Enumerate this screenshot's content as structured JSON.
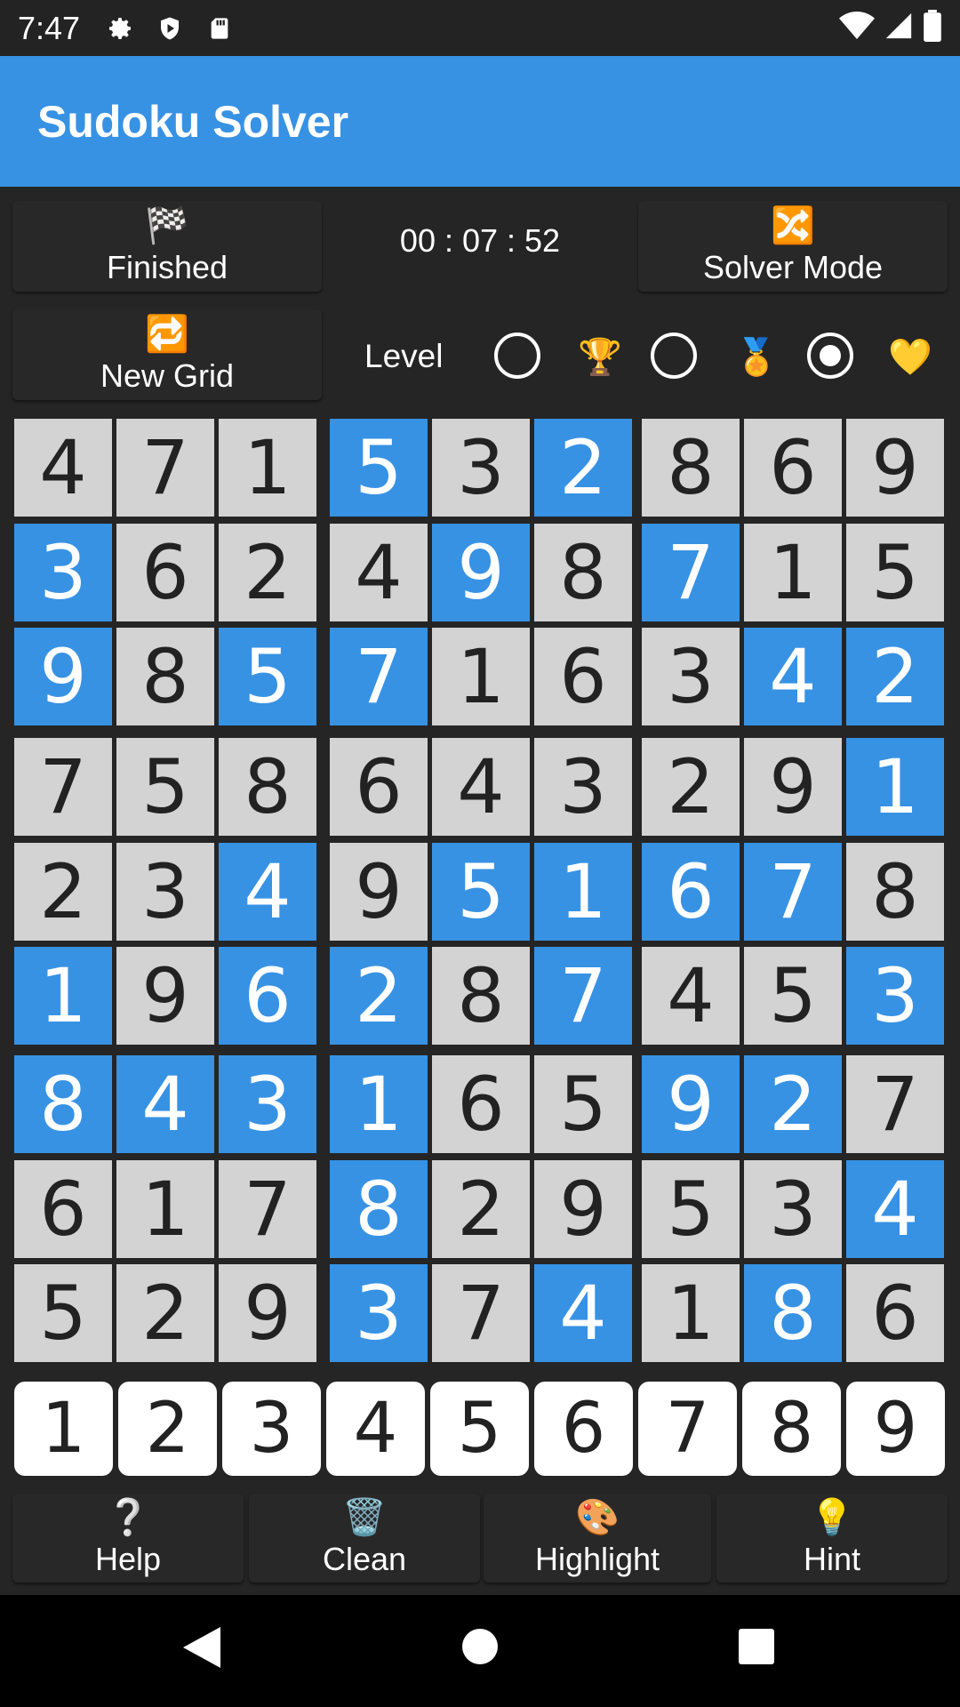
{
  "status_bar": {
    "time": "7:47"
  },
  "app": {
    "title": "Sudoku Solver"
  },
  "controls": {
    "finished": {
      "icon": "🏁",
      "label": "Finished"
    },
    "timer": "00 : 07 : 52",
    "solver_mode": {
      "icon": "🔀",
      "label": "Solver Mode"
    },
    "new_grid": {
      "icon": "🔁",
      "label": "New Grid"
    },
    "level": {
      "label": "Level",
      "options": [
        {
          "icon": "🏆",
          "selected": false
        },
        {
          "icon": "🏅",
          "selected": false
        },
        {
          "icon": "💛",
          "selected": true
        }
      ]
    }
  },
  "grid": {
    "rows": [
      [
        4,
        7,
        1,
        5,
        3,
        2,
        8,
        6,
        9
      ],
      [
        3,
        6,
        2,
        4,
        9,
        8,
        7,
        1,
        5
      ],
      [
        9,
        8,
        5,
        7,
        1,
        6,
        3,
        4,
        2
      ],
      [
        7,
        5,
        8,
        6,
        4,
        3,
        2,
        9,
        1
      ],
      [
        2,
        3,
        4,
        9,
        5,
        1,
        6,
        7,
        8
      ],
      [
        1,
        9,
        6,
        2,
        8,
        7,
        4,
        5,
        3
      ],
      [
        8,
        4,
        3,
        1,
        6,
        5,
        9,
        2,
        7
      ],
      [
        6,
        1,
        7,
        8,
        2,
        9,
        5,
        3,
        4
      ],
      [
        5,
        2,
        9,
        3,
        7,
        4,
        1,
        8,
        6
      ]
    ],
    "solved_mask": [
      [
        0,
        0,
        0,
        1,
        0,
        1,
        0,
        0,
        0
      ],
      [
        1,
        0,
        0,
        0,
        1,
        0,
        1,
        0,
        0
      ],
      [
        1,
        0,
        1,
        1,
        0,
        0,
        0,
        1,
        1
      ],
      [
        0,
        0,
        0,
        0,
        0,
        0,
        0,
        0,
        1
      ],
      [
        0,
        0,
        1,
        0,
        1,
        1,
        1,
        1,
        0
      ],
      [
        1,
        0,
        1,
        1,
        0,
        1,
        0,
        0,
        1
      ],
      [
        1,
        1,
        1,
        1,
        0,
        0,
        1,
        1,
        0
      ],
      [
        0,
        0,
        0,
        1,
        0,
        0,
        0,
        0,
        1
      ],
      [
        0,
        0,
        0,
        1,
        0,
        1,
        0,
        1,
        0
      ]
    ]
  },
  "keypad": [
    "1",
    "2",
    "3",
    "4",
    "5",
    "6",
    "7",
    "8",
    "9"
  ],
  "bottom_actions": [
    {
      "icon": "❔",
      "label": "Help"
    },
    {
      "icon": "🗑️",
      "label": "Clean"
    },
    {
      "icon": "🎨",
      "label": "Highlight"
    },
    {
      "icon": "💡",
      "label": "Hint"
    }
  ],
  "colors": {
    "accent": "#3792e4",
    "given_cell": "#d3d3d3",
    "background": "#252525"
  }
}
